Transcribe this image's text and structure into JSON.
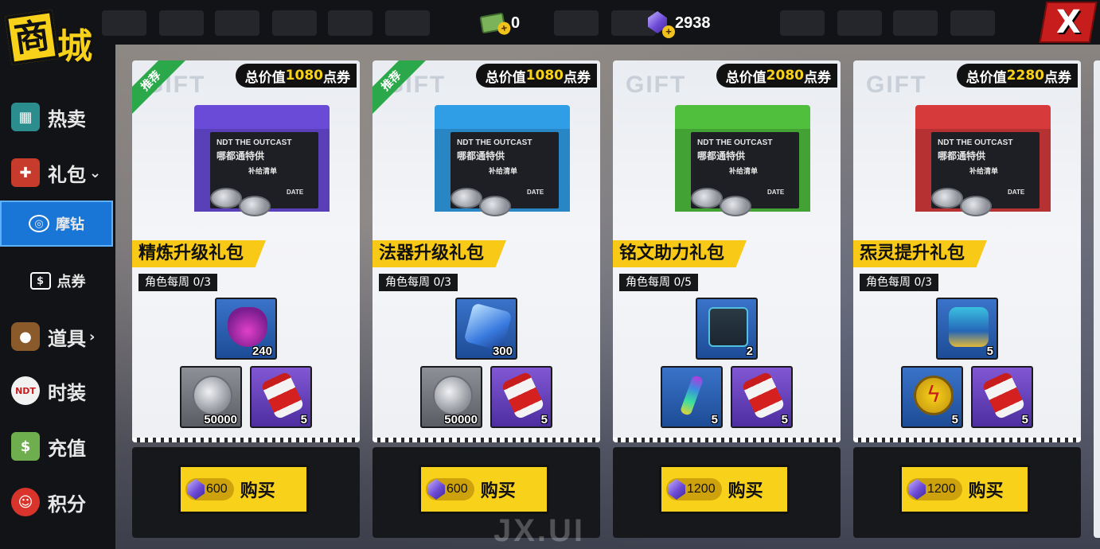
{
  "header": {
    "logo_box": "商",
    "logo_text": "城",
    "cash_amount": "0",
    "gem_amount": "2938",
    "close_label": "X"
  },
  "sidebar": {
    "items": [
      {
        "label": "热卖",
        "icon": "basket-icon"
      },
      {
        "label": "礼包",
        "icon": "gift-icon"
      },
      {
        "label": "摩钻",
        "icon": "gem-ring-icon",
        "active": true
      },
      {
        "label": "点券",
        "icon": "voucher-icon"
      },
      {
        "label": "道具",
        "icon": "barrel-icon"
      },
      {
        "label": "时装",
        "icon": "cap-icon"
      },
      {
        "label": "充值",
        "icon": "money-icon"
      },
      {
        "label": "积分",
        "icon": "chip-icon"
      }
    ]
  },
  "cards": [
    {
      "recommend": "推荐",
      "price_prefix": "总价值",
      "price_value": "1080",
      "price_suffix": "点券",
      "name": "精炼升级礼包",
      "weekly": "角色每周 0/3",
      "rewards": [
        {
          "qty": "240",
          "icon": "purple-potion-icon"
        },
        {
          "qty": "50000",
          "icon": "silver-coin-icon"
        },
        {
          "qty": "5",
          "icon": "red-vial-icon"
        }
      ],
      "buy_price": "600",
      "buy_label": "购买",
      "box_color": "#6a4bd8"
    },
    {
      "recommend": "推荐",
      "price_prefix": "总价值",
      "price_value": "1080",
      "price_suffix": "点券",
      "name": "法器升级礼包",
      "weekly": "角色每周 0/3",
      "rewards": [
        {
          "qty": "300",
          "icon": "crystal-cube-icon"
        },
        {
          "qty": "50000",
          "icon": "silver-coin-icon"
        },
        {
          "qty": "5",
          "icon": "red-vial-icon"
        }
      ],
      "buy_price": "600",
      "buy_label": "购买",
      "box_color": "#2f9ee6"
    },
    {
      "price_prefix": "总价值",
      "price_value": "2080",
      "price_suffix": "点券",
      "name": "铭文助力礼包",
      "weekly": "角色每周 0/5",
      "rewards": [
        {
          "qty": "2",
          "icon": "pouch-icon"
        },
        {
          "qty": "5",
          "icon": "rainbow-pen-icon"
        },
        {
          "qty": "5",
          "icon": "red-vial-icon"
        }
      ],
      "buy_price": "1200",
      "buy_label": "购买",
      "box_color": "#4fbf3d"
    },
    {
      "price_prefix": "总价值",
      "price_value": "2280",
      "price_suffix": "点券",
      "name": "炁灵提升礼包",
      "weekly": "角色每周 0/3",
      "rewards": [
        {
          "qty": "5",
          "icon": "charm-bag-icon"
        },
        {
          "qty": "5",
          "icon": "lightning-coin-icon"
        },
        {
          "qty": "5",
          "icon": "red-vial-icon"
        }
      ],
      "buy_price": "1200",
      "buy_label": "购买",
      "box_color": "#d63a3a"
    }
  ],
  "box_art": {
    "brand": "NDT THE OUTCAST",
    "sub": "哪都通特供",
    "sub2": "补给清单",
    "date": "DATE"
  },
  "gift_bg": "GIFT",
  "watermark": "JX.UI"
}
